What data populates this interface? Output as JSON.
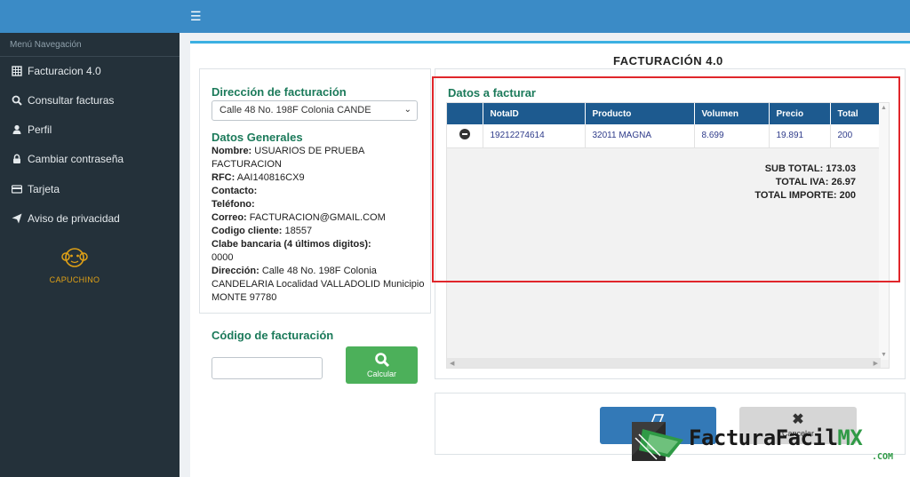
{
  "sidebar": {
    "menu_title": "Menú Navegación",
    "items": [
      {
        "label": "Facturacion 4.0",
        "icon": "invoice-icon"
      },
      {
        "label": "Consultar facturas",
        "icon": "search-icon"
      },
      {
        "label": "Perfil",
        "icon": "user-icon"
      },
      {
        "label": "Cambiar contraseña",
        "icon": "lock-icon"
      },
      {
        "label": "Tarjeta",
        "icon": "card-icon"
      },
      {
        "label": "Aviso de privacidad",
        "icon": "send-icon"
      }
    ],
    "logo_text": "CAPUCHINO"
  },
  "page_title": "FACTURACIÓN 4.0",
  "billing": {
    "heading": "Dirección de facturación",
    "address_select": "Calle 48 No. 198F Colonia CANDE",
    "general_heading": "Datos Generales",
    "nombre_label": "Nombre:",
    "nombre_value": "USUARIOS DE PRUEBA FACTURACION",
    "rfc_label": "RFC:",
    "rfc_value": "AAI140816CX9",
    "contacto_label": "Contacto:",
    "telefono_label": "Teléfono:",
    "correo_label": "Correo:",
    "correo_value": "FACTURACION@GMAIL.COM",
    "codigo_cliente_label": "Codigo cliente:",
    "codigo_cliente_value": "18557",
    "clabe_label": "Clabe bancaria (4 últimos digitos):",
    "clabe_value": "0000",
    "direccion_label": "Dirección:",
    "direccion_value": "Calle 48 No. 198F Colonia CANDELARIA Localidad VALLADOLID Municipio MONTE 97780"
  },
  "code_section": {
    "heading": "Código de facturación",
    "input_value": "",
    "calc_label": "Calcular"
  },
  "invoice": {
    "heading": "Datos a facturar",
    "columns": [
      "NotaID",
      "Producto",
      "Volumen",
      "Precio",
      "Total"
    ],
    "rows": [
      {
        "nota_id": "19212274614",
        "producto": "32011 MAGNA",
        "volumen": "8.699",
        "precio": "19.891",
        "total": "200"
      }
    ],
    "subtotal": "SUB TOTAL: 173.03",
    "iva": "TOTAL IVA: 26.97",
    "importe": "TOTAL IMPORTE: 200"
  },
  "actions": {
    "cancel_label": "Cancelar"
  },
  "watermark": {
    "brand": "FacturaFacil",
    "brand_suffix": "MX",
    "domain": ".COM"
  },
  "colors": {
    "topbar": "#3b8bc6",
    "sidebar": "#24313a",
    "accent_green": "#4cb05a",
    "table_header": "#1d5a8f",
    "highlight": "#e0262b"
  }
}
